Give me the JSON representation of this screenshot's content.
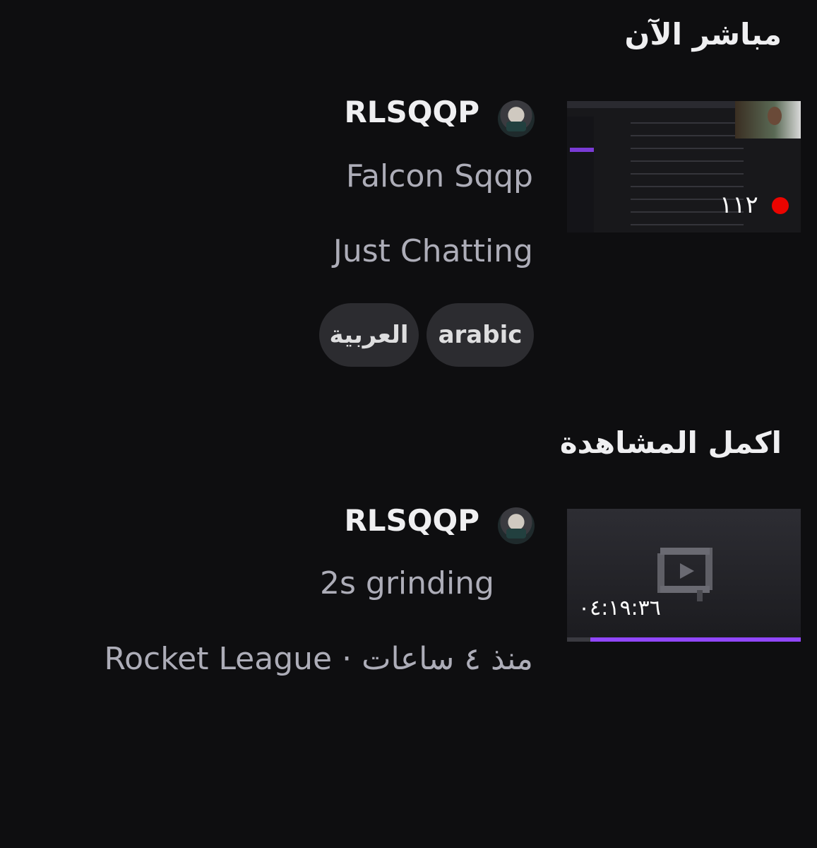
{
  "sections": {
    "live_now": "مباشر الآن",
    "continue_watching": "اكمل المشاهدة"
  },
  "live_stream": {
    "channel": "RLSQQP",
    "title": "Falcon Sqqp",
    "category": "Just Chatting",
    "viewer_count": "١١٢",
    "live_indicator_color": "#eb0400",
    "tags": [
      "arabic",
      "العربية"
    ]
  },
  "vod": {
    "channel": "RLSQQP",
    "title": "2s grinding",
    "meta": "منذ ٤ ساعات · Rocket League",
    "duration": "٠٤:١٩:٣٦",
    "watch_progress_percent": 90,
    "progress_color": "#9147ff"
  },
  "theme": {
    "background": "#0e0e10",
    "tag_background": "#2c2c30",
    "muted_text": "#adadb8"
  }
}
